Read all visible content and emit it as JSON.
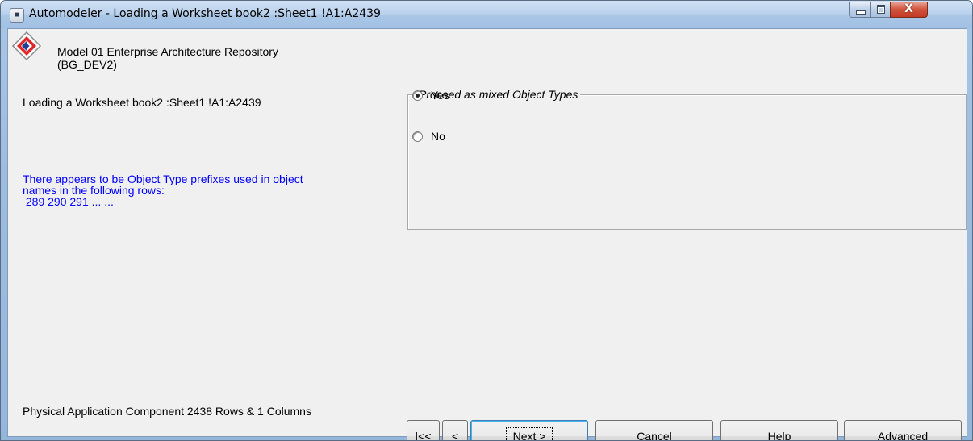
{
  "window": {
    "title": "Automodeler - Loading a Worksheet book2 :Sheet1 !A1:A2439",
    "app_icon": "automodeler-app-icon",
    "controls": {
      "minimize_icon": "minimize-icon",
      "maximize_icon": "maximize-icon",
      "close_label": "X"
    }
  },
  "left_panel": {
    "logo_icon": "repository-logo-icon",
    "model_name_line1": "Model 01 Enterprise Architecture Repository",
    "model_name_line2": "(BG_DEV2)",
    "loading_text": "Loading a Worksheet book2 :Sheet1 !A1:A2439",
    "notice_line1": "There appears to be Object Type prefixes used in object",
    "notice_line2": "names in the following rows:",
    "notice_line3": " 289 290 291 ... ...",
    "summary_text": "Physical Application Component 2438 Rows & 1 Columns"
  },
  "options_group": {
    "label": "Proceed as mixed Object Types",
    "options": [
      {
        "label": "Yes",
        "selected": true
      },
      {
        "label": "No",
        "selected": false
      }
    ]
  },
  "buttons": {
    "first": "|<<",
    "prev": "<",
    "next": {
      "pre": "",
      "mnemonic": "N",
      "post": "ext >"
    },
    "cancel": {
      "pre": "",
      "mnemonic": "C",
      "post": "ancel"
    },
    "help": {
      "pre": "",
      "mnemonic": "H",
      "post": "elp"
    },
    "advanced": {
      "pre": "Ad",
      "mnemonic": "v",
      "post": "anced"
    }
  },
  "colors": {
    "notice_text": "#0000ff",
    "titlebar": "#bcd3ee",
    "client_background": "#f0f0f0",
    "close_button": "#d2543e"
  }
}
